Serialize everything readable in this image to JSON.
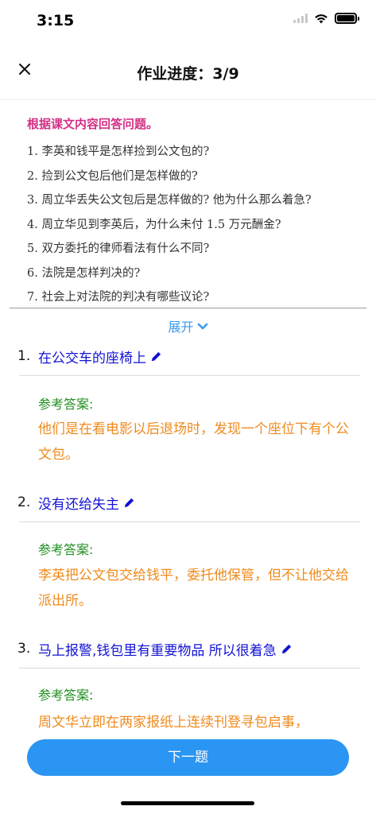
{
  "status_bar": {
    "time": "3:15"
  },
  "nav": {
    "title": "作业进度：3/9"
  },
  "questions": {
    "heading": "根据课文内容回答问题。",
    "items": [
      "1. 李英和钱平是怎样捡到公文包的?",
      "2. 捡到公文包后他们是怎样做的?",
      "3. 周立华丢失公文包后是怎样做的? 他为什么那么着急?",
      "4. 周立华见到李英后，为什么未付 1.5 万元酬金?",
      "5. 双方委托的律师看法有什么不同?",
      "6. 法院是怎样判决的?",
      "7. 社会上对法院的判决有哪些议论?"
    ]
  },
  "expand_label": "展开",
  "answers": [
    {
      "number": "1.",
      "text": "在公交车的座椅上",
      "reference_label": "参考答案:",
      "reference_text": "他们是在看电影以后退场时，发现一个座位下有个公文包。"
    },
    {
      "number": "2.",
      "text": "没有还给失主",
      "reference_label": "参考答案:",
      "reference_text": "李英把公文包交给钱平，委托他保管，但不让他交给派出所。"
    },
    {
      "number": "3.",
      "text": "马上报警,钱包里有重要物品 所以很着急",
      "reference_label": "参考答案:",
      "reference_text": "周文华立即在两家报纸上连续刊登寻包启事，"
    }
  ],
  "next_button": {
    "label": "下一题"
  },
  "colors": {
    "accent": "#2a95f2",
    "heading_pink": "#d42f86",
    "answer_blue": "#1212d6",
    "reference_green": "#1f8f1f",
    "reference_orange": "#f08a1c",
    "expand_blue": "#3b9bef"
  },
  "icons": {
    "close": "close-icon",
    "pencil": "pencil-icon",
    "chevron": "chevron-down-icon",
    "wifi": "wifi-icon",
    "battery": "battery-icon",
    "signal": "signal-icon"
  }
}
